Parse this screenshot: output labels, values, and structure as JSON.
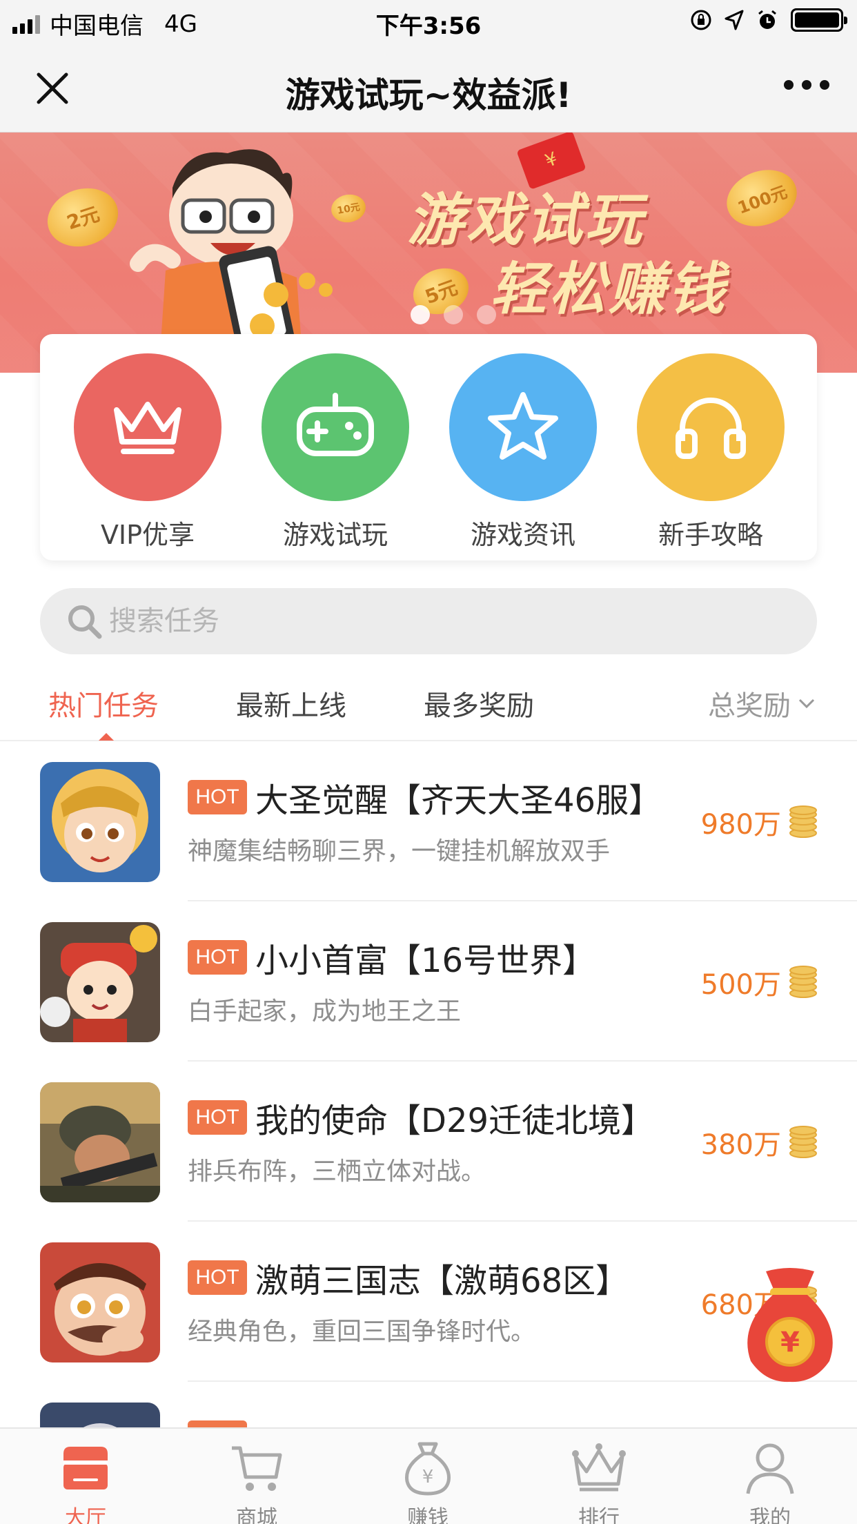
{
  "status_bar": {
    "carrier": "中国电信",
    "network": "4G",
    "time": "下午3:56"
  },
  "navbar": {
    "title": "游戏试玩~效益派!",
    "close_icon": "close-icon",
    "more_icon": "more-icon"
  },
  "banner": {
    "line1": "游戏试玩",
    "line2": "轻松赚钱",
    "coin_labels": [
      "2元",
      "10元",
      "5元",
      "100元"
    ],
    "slides": 3,
    "active_slide": 1
  },
  "categories": [
    {
      "label": "VIP优享",
      "icon": "crown-icon",
      "color": "#ea6661"
    },
    {
      "label": "游戏试玩",
      "icon": "gamepad-icon",
      "color": "#5cc470"
    },
    {
      "label": "游戏资讯",
      "icon": "star-icon",
      "color": "#57b3f2"
    },
    {
      "label": "新手攻略",
      "icon": "headphones-icon",
      "color": "#f4bf45"
    }
  ],
  "search": {
    "placeholder": "搜索任务",
    "value": ""
  },
  "tabs": [
    {
      "label": "热门任务",
      "active": true
    },
    {
      "label": "最新上线",
      "active": false
    },
    {
      "label": "最多奖励",
      "active": false
    }
  ],
  "sort": {
    "label": "总奖励"
  },
  "tasks": [
    {
      "badge": "HOT",
      "name": "大圣觉醒【齐天大圣46服】",
      "desc": "神魔集结畅聊三界，一键挂机解放双手",
      "reward": "980万"
    },
    {
      "badge": "HOT",
      "name": "小小首富【16号世界】",
      "desc": "白手起家，成为地王之王",
      "reward": "500万"
    },
    {
      "badge": "HOT",
      "name": "我的使命【D29迁徒北境】",
      "desc": "排兵布阵，三栖立体对战。",
      "reward": "380万"
    },
    {
      "badge": "HOT",
      "name": "激萌三国志【激萌68区】",
      "desc": "经典角色，重回三国争锋时代。",
      "reward": "680万"
    },
    {
      "badge": "HOT",
      "name": "",
      "desc": "",
      "reward": ""
    }
  ],
  "red_envelope": {
    "symbol": "¥"
  },
  "tabbar": [
    {
      "label": "大厅",
      "icon": "store-icon",
      "active": true
    },
    {
      "label": "商城",
      "icon": "cart-icon",
      "active": false
    },
    {
      "label": "赚钱",
      "icon": "money-bag-icon",
      "active": false
    },
    {
      "label": "排行",
      "icon": "crown-icon",
      "active": false
    },
    {
      "label": "我的",
      "icon": "person-icon",
      "active": false
    }
  ],
  "colors": {
    "accent": "#ef6450",
    "reward": "#ef7b2a",
    "hot_badge": "#f0774a",
    "banner": "#ee7d74"
  }
}
